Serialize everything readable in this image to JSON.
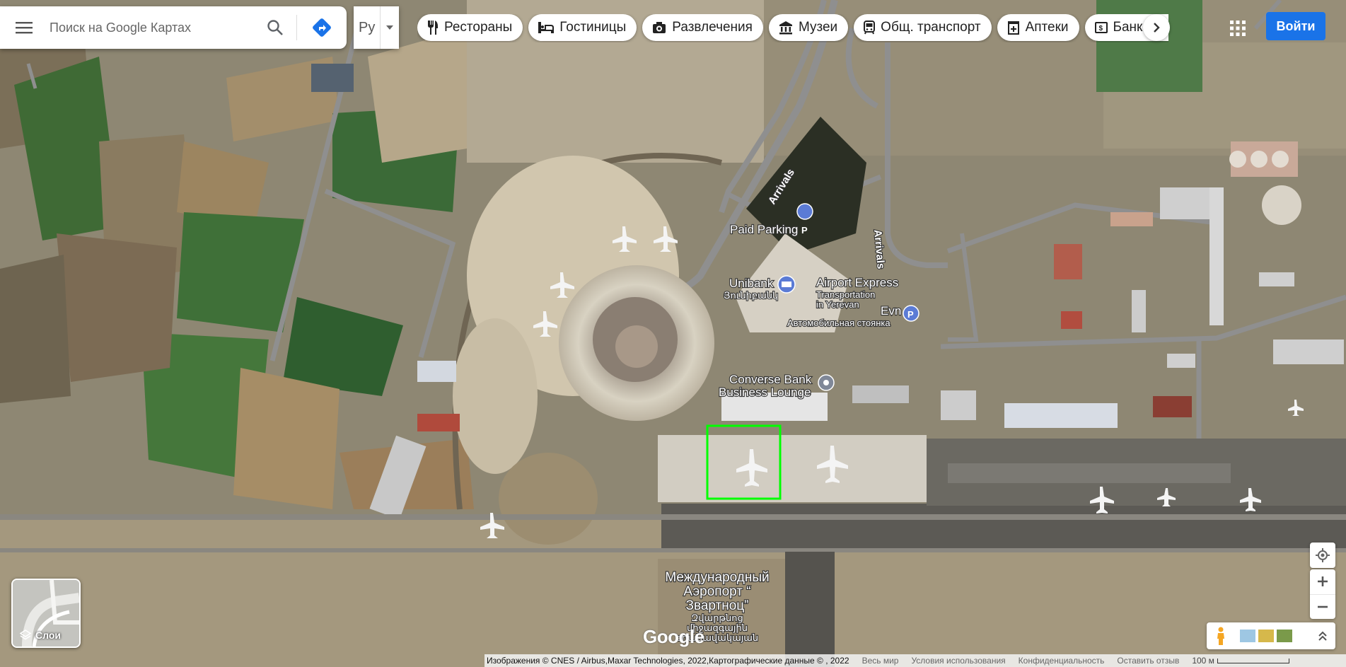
{
  "search": {
    "placeholder": "Поиск на Google Картах"
  },
  "language": {
    "label": "Ру"
  },
  "categories": [
    {
      "label": "Рестораны",
      "icon": "restaurant-icon"
    },
    {
      "label": "Гостиницы",
      "icon": "hotel-icon"
    },
    {
      "label": "Развлечения",
      "icon": "entertainment-icon"
    },
    {
      "label": "Музеи",
      "icon": "museum-icon"
    },
    {
      "label": "Общ. транспорт",
      "icon": "transit-icon"
    },
    {
      "label": "Аптеки",
      "icon": "pharmacy-icon"
    },
    {
      "label": "Банкоматы",
      "icon": "atm-icon"
    }
  ],
  "signin": {
    "label": "Войти"
  },
  "map_labels": {
    "arrivals_1": "Arrivals",
    "arrivals_2": "Arrivals",
    "paid_parking": "Paid Parking",
    "unibank": "Unibank",
    "unibank_sub": "Յունիբանկ",
    "airport_express": "Airport Express",
    "airport_express_sub1": "Transportation",
    "airport_express_sub2": "in Yerevan",
    "evn": "Evn",
    "auto_parking": "Автомобильная стоянка",
    "converse_bank": "Converse Bank",
    "business_lounge": "Business Lounge",
    "airport_name_1": "Международный",
    "airport_name_2": "Аэропорт “",
    "airport_name_3": "Звартноц”",
    "airport_arm_1": "Զվարթնոց",
    "airport_arm_2": "միջազգային",
    "airport_arm_3": "օդանավակայան"
  },
  "layers": {
    "label": "Слои"
  },
  "logo": {
    "text": "Google"
  },
  "footer": {
    "attribution": "Изображения © CNES / Airbus,Maxar Technologies, 2022,Картографические данные © , 2022",
    "world": "Весь мир",
    "terms": "Условия использования",
    "privacy": "Конфиденциальность",
    "feedback": "Оставить отзыв",
    "scale": "100 м"
  },
  "colors": {
    "accent": "#1a73e8",
    "directions": "#1a73e8",
    "poi_pin": "#5b7bd5",
    "highlight_box": "#00ff00"
  }
}
